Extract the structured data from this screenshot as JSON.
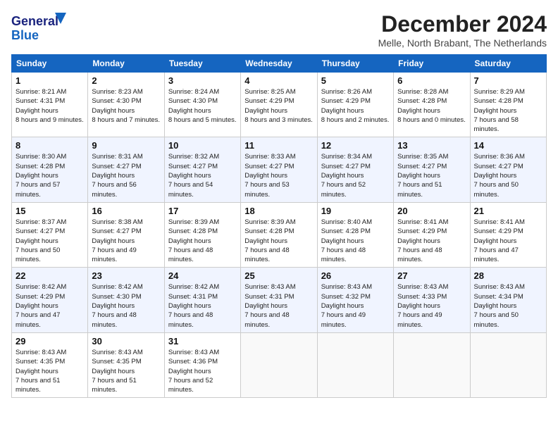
{
  "logo": {
    "line1": "General",
    "line2": "Blue"
  },
  "title": "December 2024",
  "location": "Melle, North Brabant, The Netherlands",
  "days_of_week": [
    "Sunday",
    "Monday",
    "Tuesday",
    "Wednesday",
    "Thursday",
    "Friday",
    "Saturday"
  ],
  "weeks": [
    [
      {
        "day": "1",
        "sunrise": "8:21 AM",
        "sunset": "4:31 PM",
        "daylight": "8 hours and 9 minutes."
      },
      {
        "day": "2",
        "sunrise": "8:23 AM",
        "sunset": "4:30 PM",
        "daylight": "8 hours and 7 minutes."
      },
      {
        "day": "3",
        "sunrise": "8:24 AM",
        "sunset": "4:30 PM",
        "daylight": "8 hours and 5 minutes."
      },
      {
        "day": "4",
        "sunrise": "8:25 AM",
        "sunset": "4:29 PM",
        "daylight": "8 hours and 3 minutes."
      },
      {
        "day": "5",
        "sunrise": "8:26 AM",
        "sunset": "4:29 PM",
        "daylight": "8 hours and 2 minutes."
      },
      {
        "day": "6",
        "sunrise": "8:28 AM",
        "sunset": "4:28 PM",
        "daylight": "8 hours and 0 minutes."
      },
      {
        "day": "7",
        "sunrise": "8:29 AM",
        "sunset": "4:28 PM",
        "daylight": "7 hours and 58 minutes."
      }
    ],
    [
      {
        "day": "8",
        "sunrise": "8:30 AM",
        "sunset": "4:28 PM",
        "daylight": "7 hours and 57 minutes."
      },
      {
        "day": "9",
        "sunrise": "8:31 AM",
        "sunset": "4:27 PM",
        "daylight": "7 hours and 56 minutes."
      },
      {
        "day": "10",
        "sunrise": "8:32 AM",
        "sunset": "4:27 PM",
        "daylight": "7 hours and 54 minutes."
      },
      {
        "day": "11",
        "sunrise": "8:33 AM",
        "sunset": "4:27 PM",
        "daylight": "7 hours and 53 minutes."
      },
      {
        "day": "12",
        "sunrise": "8:34 AM",
        "sunset": "4:27 PM",
        "daylight": "7 hours and 52 minutes."
      },
      {
        "day": "13",
        "sunrise": "8:35 AM",
        "sunset": "4:27 PM",
        "daylight": "7 hours and 51 minutes."
      },
      {
        "day": "14",
        "sunrise": "8:36 AM",
        "sunset": "4:27 PM",
        "daylight": "7 hours and 50 minutes."
      }
    ],
    [
      {
        "day": "15",
        "sunrise": "8:37 AM",
        "sunset": "4:27 PM",
        "daylight": "7 hours and 50 minutes."
      },
      {
        "day": "16",
        "sunrise": "8:38 AM",
        "sunset": "4:27 PM",
        "daylight": "7 hours and 49 minutes."
      },
      {
        "day": "17",
        "sunrise": "8:39 AM",
        "sunset": "4:28 PM",
        "daylight": "7 hours and 48 minutes."
      },
      {
        "day": "18",
        "sunrise": "8:39 AM",
        "sunset": "4:28 PM",
        "daylight": "7 hours and 48 minutes."
      },
      {
        "day": "19",
        "sunrise": "8:40 AM",
        "sunset": "4:28 PM",
        "daylight": "7 hours and 48 minutes."
      },
      {
        "day": "20",
        "sunrise": "8:41 AM",
        "sunset": "4:29 PM",
        "daylight": "7 hours and 48 minutes."
      },
      {
        "day": "21",
        "sunrise": "8:41 AM",
        "sunset": "4:29 PM",
        "daylight": "7 hours and 47 minutes."
      }
    ],
    [
      {
        "day": "22",
        "sunrise": "8:42 AM",
        "sunset": "4:29 PM",
        "daylight": "7 hours and 47 minutes."
      },
      {
        "day": "23",
        "sunrise": "8:42 AM",
        "sunset": "4:30 PM",
        "daylight": "7 hours and 48 minutes."
      },
      {
        "day": "24",
        "sunrise": "8:42 AM",
        "sunset": "4:31 PM",
        "daylight": "7 hours and 48 minutes."
      },
      {
        "day": "25",
        "sunrise": "8:43 AM",
        "sunset": "4:31 PM",
        "daylight": "7 hours and 48 minutes."
      },
      {
        "day": "26",
        "sunrise": "8:43 AM",
        "sunset": "4:32 PM",
        "daylight": "7 hours and 49 minutes."
      },
      {
        "day": "27",
        "sunrise": "8:43 AM",
        "sunset": "4:33 PM",
        "daylight": "7 hours and 49 minutes."
      },
      {
        "day": "28",
        "sunrise": "8:43 AM",
        "sunset": "4:34 PM",
        "daylight": "7 hours and 50 minutes."
      }
    ],
    [
      {
        "day": "29",
        "sunrise": "8:43 AM",
        "sunset": "4:35 PM",
        "daylight": "7 hours and 51 minutes."
      },
      {
        "day": "30",
        "sunrise": "8:43 AM",
        "sunset": "4:35 PM",
        "daylight": "7 hours and 51 minutes."
      },
      {
        "day": "31",
        "sunrise": "8:43 AM",
        "sunset": "4:36 PM",
        "daylight": "7 hours and 52 minutes."
      },
      null,
      null,
      null,
      null
    ]
  ],
  "labels": {
    "sunrise": "Sunrise:",
    "sunset": "Sunset:",
    "daylight": "Daylight hours"
  }
}
